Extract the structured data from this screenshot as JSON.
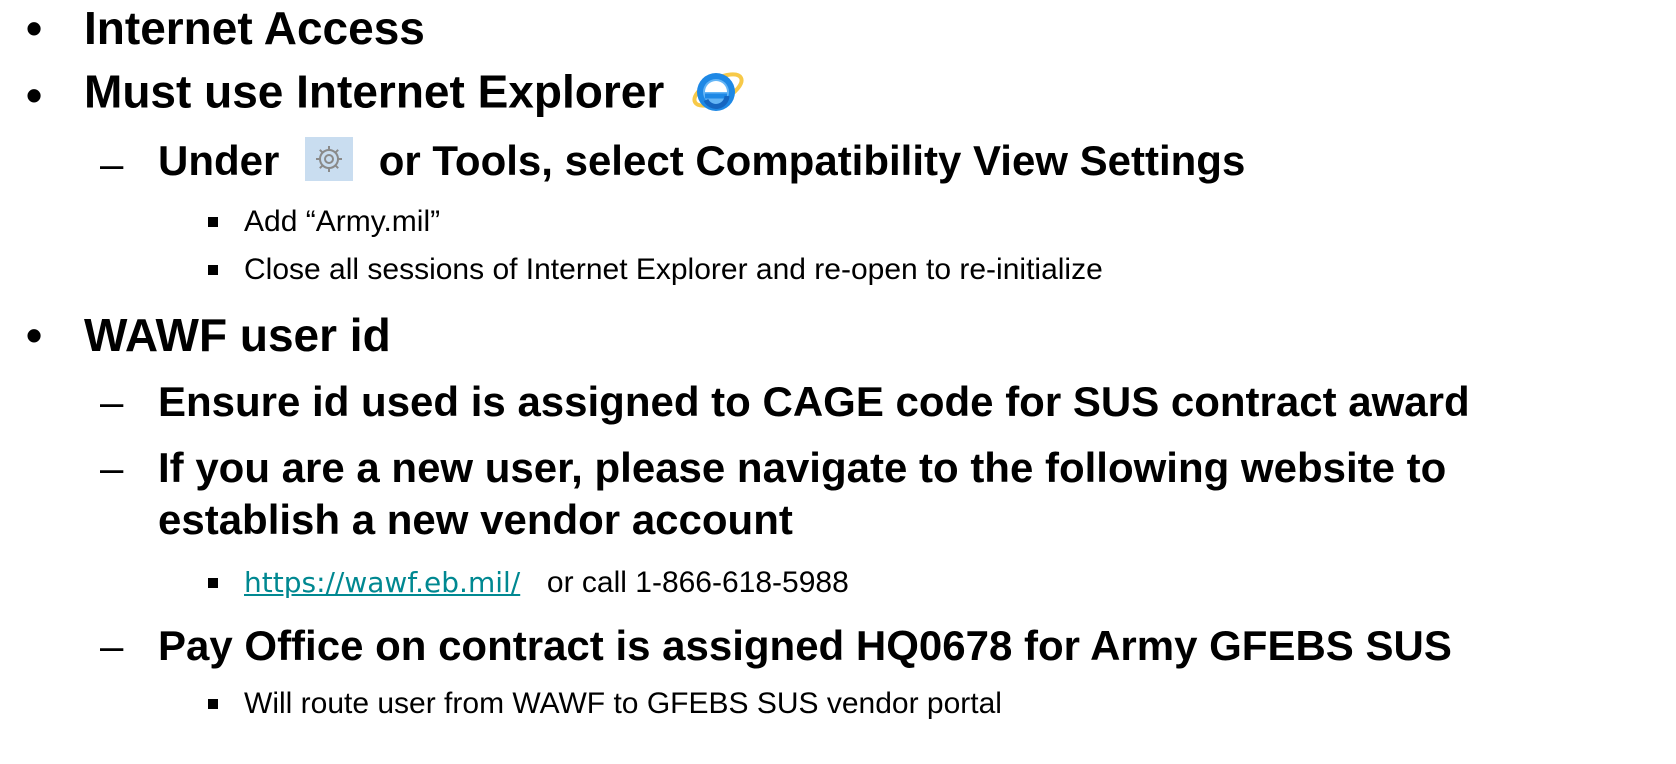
{
  "bullets": {
    "l1_marker": "•",
    "l2_marker": "–"
  },
  "items": {
    "internet_access": "Internet Access",
    "must_use_ie": "Must use Internet Explorer",
    "under_prefix": "Under",
    "under_suffix": "or Tools, select Compatibility View Settings",
    "add_army": "Add “Army.mil”",
    "close_sessions": "Close all sessions of Internet Explorer and re-open to re-initialize",
    "wawf_user_id": "WAWF user id",
    "ensure_id": "Ensure id used is assigned to CAGE code for SUS contract award",
    "new_user_line1": "If you are a new user, please navigate to the following website to",
    "new_user_line2": "establish a new vendor account",
    "wawf_link": "https://wawf.eb.mil/",
    "or_call": "or call 1-866-618-5988",
    "pay_office": "Pay Office on contract is assigned HQ0678 for Army GFEBS SUS",
    "route_user": "Will route user from WAWF to GFEBS SUS vendor portal"
  },
  "icons": {
    "ie_logo": "internet-explorer-icon",
    "gear": "gear-icon"
  },
  "colors": {
    "link": "#008891",
    "ie_blue": "#1E88E5",
    "ie_ring": "#F7C948",
    "gear_bg": "#C9DDF0"
  }
}
